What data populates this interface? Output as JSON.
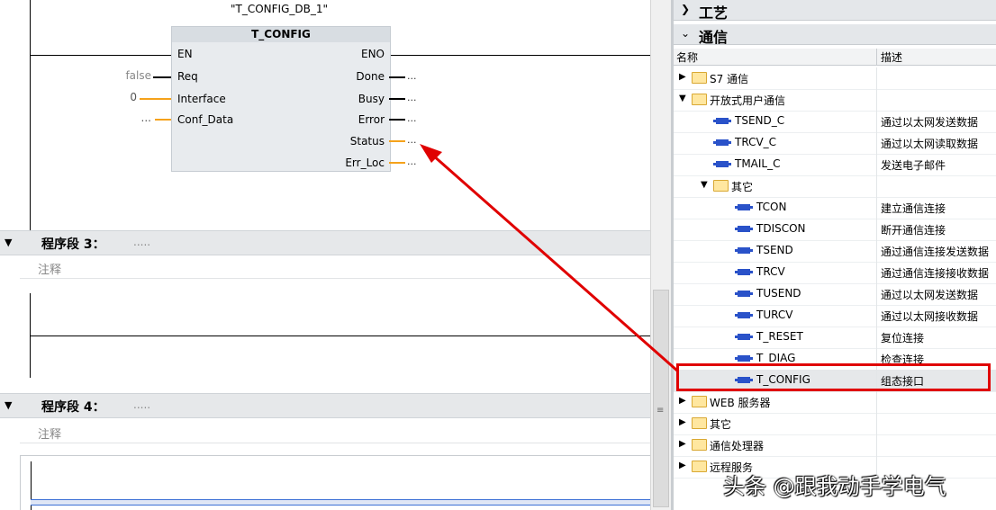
{
  "editor": {
    "db_instance": "\"T_CONFIG_DB_1\"",
    "block": {
      "title": "T_CONFIG",
      "inputs": [
        {
          "name": "EN",
          "value": ""
        },
        {
          "name": "Req",
          "value": "false"
        },
        {
          "name": "Interface",
          "value": "0"
        },
        {
          "name": "Conf_Data",
          "value": "..."
        }
      ],
      "outputs": [
        {
          "name": "ENO",
          "value": ""
        },
        {
          "name": "Done",
          "value": "..."
        },
        {
          "name": "Busy",
          "value": "..."
        },
        {
          "name": "Error",
          "value": "..."
        },
        {
          "name": "Status",
          "value": "..."
        },
        {
          "name": "Err_Loc",
          "value": "..."
        }
      ]
    },
    "networks": [
      {
        "title": "程序段 3：",
        "placeholder": ".....",
        "comment": "注释"
      },
      {
        "title": "程序段 4：",
        "placeholder": ".....",
        "comment": "注释"
      }
    ]
  },
  "scrollbar": {
    "grip": "≡"
  },
  "tasks": {
    "sections": [
      {
        "label": "工艺",
        "expanded": false
      },
      {
        "label": "通信",
        "expanded": true
      }
    ],
    "columns": {
      "name": "名称",
      "description": "描述"
    },
    "rows": [
      {
        "name": "S7 通信",
        "desc": "",
        "type": "folder",
        "expanded": false
      },
      {
        "name": "开放式用户通信",
        "desc": "",
        "type": "folder",
        "expanded": true
      },
      {
        "name": "TSEND_C",
        "desc": "通过以太网发送数据",
        "type": "block"
      },
      {
        "name": "TRCV_C",
        "desc": "通过以太网读取数据",
        "type": "block"
      },
      {
        "name": "TMAIL_C",
        "desc": "发送电子邮件",
        "type": "block"
      },
      {
        "name": "其它",
        "desc": "",
        "type": "folder",
        "expanded": true
      },
      {
        "name": "TCON",
        "desc": "建立通信连接",
        "type": "block"
      },
      {
        "name": "TDISCON",
        "desc": "断开通信连接",
        "type": "block"
      },
      {
        "name": "TSEND",
        "desc": "通过通信连接发送数据",
        "type": "block"
      },
      {
        "name": "TRCV",
        "desc": "通过通信连接接收数据",
        "type": "block"
      },
      {
        "name": "TUSEND",
        "desc": "通过以太网发送数据",
        "type": "block"
      },
      {
        "name": "TURCV",
        "desc": "通过以太网接收数据",
        "type": "block"
      },
      {
        "name": "T_RESET",
        "desc": "复位连接",
        "type": "block"
      },
      {
        "name": "T_DIAG",
        "desc": "检查连接",
        "type": "block"
      },
      {
        "name": "T_CONFIG",
        "desc": "组态接口",
        "type": "block",
        "selected": true
      },
      {
        "name": "WEB 服务器",
        "desc": "",
        "type": "folder",
        "expanded": false
      },
      {
        "name": "其它",
        "desc": "",
        "type": "folder",
        "expanded": false
      },
      {
        "name": "通信处理器",
        "desc": "",
        "type": "folder",
        "expanded": false
      },
      {
        "name": "远程服务",
        "desc": "",
        "type": "folder",
        "expanded": false
      }
    ]
  },
  "watermark": "头条 @跟我动手学电气",
  "colors": {
    "highlight": "#e00000",
    "wire_orange": "#f5a21b",
    "block_icon": "#2a52c9"
  }
}
